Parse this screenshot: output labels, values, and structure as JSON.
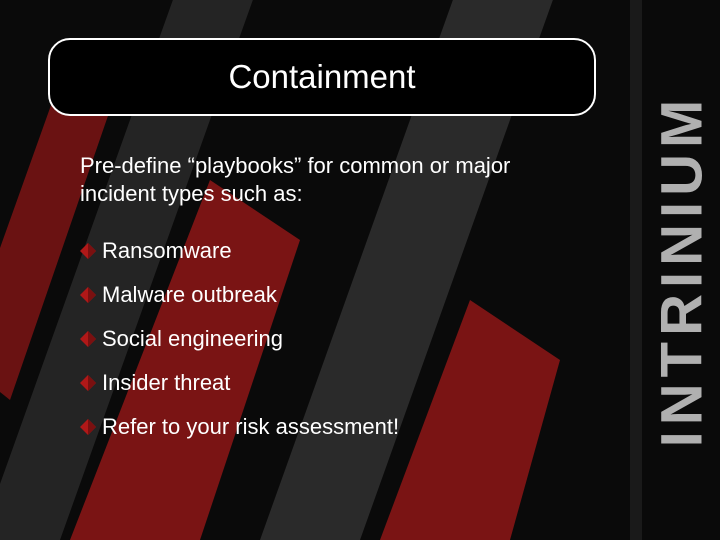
{
  "title": "Containment",
  "intro": "Pre-define “playbooks” for common or major incident types such as:",
  "items": [
    "Ransomware",
    "Malware outbreak",
    "Social engineering",
    "Insider threat",
    "Refer to your risk assessment!"
  ],
  "brand": "INTRINIUM",
  "colors": {
    "bullet": "#b01818",
    "bg_accent": "#7a1414"
  }
}
